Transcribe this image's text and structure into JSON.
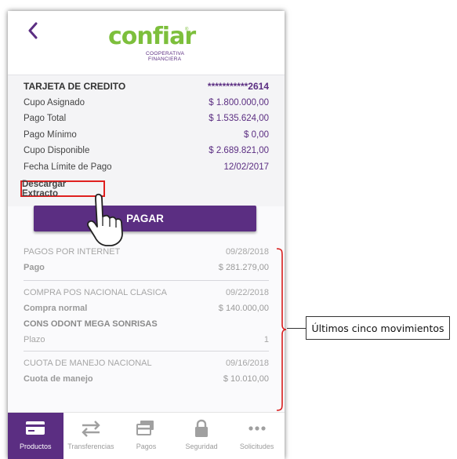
{
  "logo": {
    "word": "confiar",
    "sub_line1": "COOPERATIVA",
    "sub_line2": "FINANCIERA",
    "reg": "®"
  },
  "card": {
    "title": "TARJETA DE CREDITO",
    "number": "***********2614",
    "rows": [
      {
        "label": "Cupo Asignado",
        "value": "$ 1.800.000,00"
      },
      {
        "label": "Pago Total",
        "value": "$ 1.535.624,00"
      },
      {
        "label": "Pago Mínimo",
        "value": "$ 0,00"
      },
      {
        "label": "Cupo Disponible",
        "value": "$ 2.689.821,00"
      },
      {
        "label": "Fecha Límite de Pago",
        "value": "12/02/2017"
      }
    ]
  },
  "download_label": "Descargar Extracto",
  "pay_button": "PAGAR",
  "movements": [
    {
      "title": "PAGOS POR INTERNET",
      "date": "09/28/2018",
      "detail": "Pago",
      "amount": "$ 281.279,00"
    },
    {
      "title": "COMPRA POS NACIONAL CLASICA",
      "date": "09/22/2018",
      "detail": "Compra normal",
      "amount": "$ 140.000,00",
      "extra_title": "CONS ODONT MEGA SONRISAS",
      "extra_label": "Plazo",
      "extra_value": "1"
    },
    {
      "title": "CUOTA DE MANEJO NACIONAL",
      "date": "09/16/2018",
      "detail": "Cuota de manejo",
      "amount": "$ 10.010,00"
    }
  ],
  "tabs": [
    {
      "label": "Productos",
      "icon": "card-icon",
      "active": true
    },
    {
      "label": "Transferencias",
      "icon": "transfer-arrows-icon",
      "active": false
    },
    {
      "label": "Pagos",
      "icon": "payment-icon",
      "active": false
    },
    {
      "label": "Seguridad",
      "icon": "lock-icon",
      "active": false
    },
    {
      "label": "Solicitudes",
      "icon": "more-dots-icon",
      "active": false
    }
  ],
  "annotation": "Últimos cinco movimientos",
  "colors": {
    "brand_purple": "#5b2e82",
    "brand_green": "#7dbf3c",
    "highlight_red": "#e02020"
  }
}
